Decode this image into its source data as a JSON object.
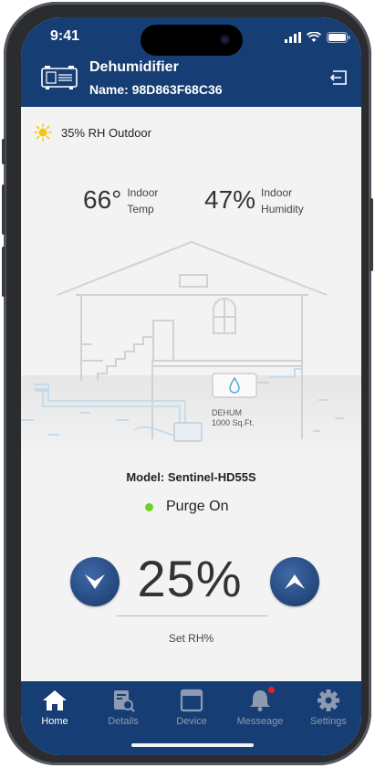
{
  "status_bar": {
    "time": "9:41"
  },
  "header": {
    "title": "Dehumidifier",
    "subtitle": "Name: 98D863F68C36"
  },
  "outdoor": {
    "text": "35% RH Outdoor"
  },
  "indoor": {
    "temp_value": "66°",
    "temp_label_1": "Indoor",
    "temp_label_2": "Temp",
    "humidity_value": "47%",
    "humidity_label_1": "Indoor",
    "humidity_label_2": "Humidity"
  },
  "house": {
    "unit_label": "DEHUM",
    "unit_area": "1000 Sq.Ft."
  },
  "model": {
    "text": "Model: Sentinel-HD55S"
  },
  "purge": {
    "text": "Purge On"
  },
  "setpoint": {
    "value": "25%",
    "label": "Set RH%"
  },
  "tabs": [
    {
      "label": "Home",
      "icon": "home-icon",
      "active": true
    },
    {
      "label": "Details",
      "icon": "details-icon",
      "active": false
    },
    {
      "label": "Device",
      "icon": "device-icon",
      "active": false
    },
    {
      "label": "Messeage",
      "icon": "bell-icon",
      "active": false
    },
    {
      "label": "Settings",
      "icon": "gear-icon",
      "active": false
    }
  ],
  "colors": {
    "header": "#173e74",
    "accent_green": "#6ed12a",
    "badge_red": "#e52222"
  }
}
